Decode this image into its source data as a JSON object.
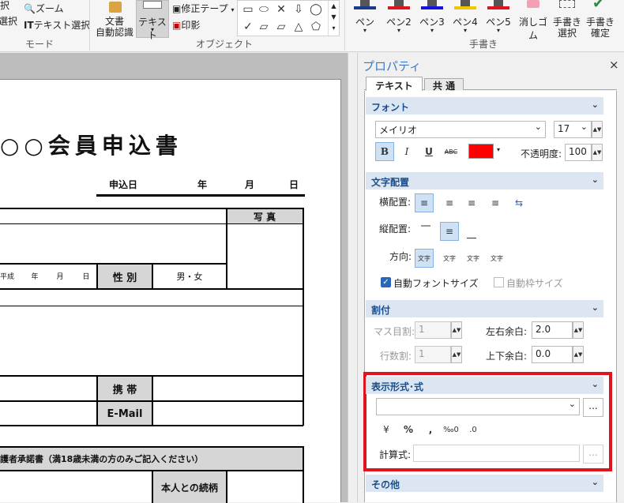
{
  "ribbon": {
    "left_top_label": "択",
    "left_bottom_label": "選択",
    "zoom_label": "ズーム",
    "text_select_label": "テキスト選択",
    "mode_group": "モード",
    "doc_recog_line1": "文書",
    "doc_recog_line2": "自動認識",
    "text_label": "テキスト",
    "correction_tape": "修正テープ",
    "stamp": "印影",
    "object_group": "オブジェクト",
    "pens": [
      "ペン",
      "ペン2",
      "ペン3",
      "ペン4",
      "ペン5"
    ],
    "pen_colors": [
      "#1a3c8a",
      "#e0141e",
      "#1414e0",
      "#f0c800",
      "#e0141e"
    ],
    "eraser": "消しゴム",
    "handwrite_select_line1": "手書き",
    "handwrite_select_line2": "選択",
    "handwrite_confirm_line1": "手書き",
    "handwrite_confirm_line2": "確定",
    "handwrite_group": "手書き"
  },
  "document": {
    "title": "○○会員申込書",
    "apply_date": "申込日",
    "year": "年",
    "month": "月",
    "day": "日",
    "photo": "写 真",
    "era": "平成",
    "birth_year": "年",
    "birth_month": "月",
    "birth_day": "日",
    "gender_label": "性 別",
    "gender_value": "男・女",
    "mobile": "携 帯",
    "email": "E-Mail",
    "guardian": "護者承諾書（満18歳未満の方のみご記入ください）",
    "relation": "本人との続柄"
  },
  "panel": {
    "title": "プロパティ",
    "close": "×",
    "tabs": [
      "テキスト",
      "共 通"
    ],
    "font_section": "フォント",
    "font_name": "メイリオ",
    "font_size": "17",
    "bold": "B",
    "italic": "I",
    "underline": "U",
    "strike": "ABC",
    "font_color": "#ff0000",
    "opacity_label": "不透明度:",
    "opacity_value": "100",
    "align_section": "文字配置",
    "h_align_label": "横配置:",
    "v_align_label": "縦配置:",
    "direction_label": "方向:",
    "auto_font_size": "自動フォントサイズ",
    "auto_frame_size": "自動枠サイズ",
    "layout_section": "割付",
    "grid_split_label": "マス目割:",
    "grid_split_value": "1",
    "row_split_label": "行数割:",
    "row_split_value": "1",
    "lr_margin_label": "左右余白:",
    "lr_margin_value": "2.0",
    "tb_margin_label": "上下余白:",
    "tb_margin_value": "0.0",
    "format_section": "表示形式･式",
    "format_value": "",
    "more": "...",
    "format_buttons": [
      "¥",
      "%",
      ",",
      "‰0",
      ".0"
    ],
    "calc_label": "計算式:",
    "calc_value": "",
    "other_section": "その他",
    "highlight_color": "#e0141e"
  }
}
